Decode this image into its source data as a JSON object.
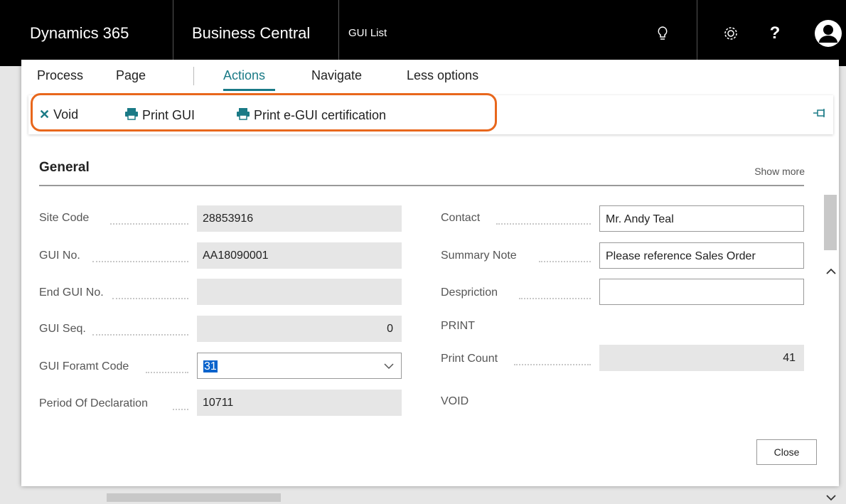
{
  "header": {
    "product": "Dynamics 365",
    "app": "Business Central",
    "page": "GUI List",
    "icons": [
      "lightbulb-icon",
      "gear-icon",
      "help-icon",
      "user-avatar-icon"
    ],
    "help_label": "?"
  },
  "menu": {
    "items": [
      "Process",
      "Page",
      "Actions",
      "Navigate",
      "Less options"
    ],
    "active": "Actions"
  },
  "actions": {
    "void": "Void",
    "print_gui": "Print GUI",
    "print_certification": "Print e-GUI certification"
  },
  "section": {
    "title": "General",
    "show_more": "Show more"
  },
  "fields_left": [
    {
      "label": "Site Code",
      "value": "28853916"
    },
    {
      "label": "GUI No.",
      "value": "AA18090001"
    },
    {
      "label": "End GUI No.",
      "value": ""
    },
    {
      "label": "GUI Seq.",
      "value": "0"
    },
    {
      "label": "GUI Foramt Code",
      "value": "31"
    },
    {
      "label": "Period Of Declaration",
      "value": "10711"
    }
  ],
  "fields_right": [
    {
      "label": "Contact",
      "value": "Mr. Andy Teal"
    },
    {
      "label": "Summary Note",
      "value": "Please reference Sales Order"
    },
    {
      "label": "Despriction",
      "value": ""
    }
  ],
  "print_section": {
    "title": "PRINT",
    "print_count_label": "Print Count",
    "print_count": "41"
  },
  "void_section": {
    "title": "VOID"
  },
  "footer": {
    "close": "Close"
  },
  "colors": {
    "accent": "#1a7a86",
    "highlight": "#e8671c",
    "selection": "#0a63cc"
  }
}
